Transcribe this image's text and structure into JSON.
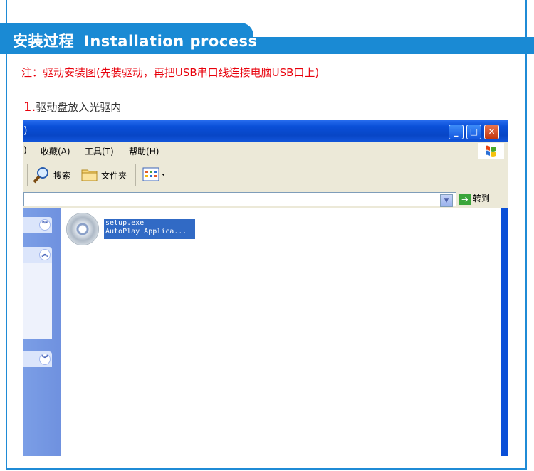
{
  "header": {
    "title_cn": "安装过程",
    "title_en": "Installation process"
  },
  "note": "注：驱动安装图(先装驱动，再把USB串口线连接电脑USB口上)",
  "step": {
    "number": "1.",
    "text": "驱动盘放入光驱内"
  },
  "window": {
    "title_fragment": ")",
    "menu": {
      "fragment": ")",
      "favorites": "收藏(A)",
      "tools": "工具(T)",
      "help": "帮助(H)"
    },
    "toolbar": {
      "search": "搜索",
      "folders": "文件夹"
    },
    "address": {
      "go": "转到"
    },
    "files": [
      "setup.exe",
      "AutoPlay Applica..."
    ]
  },
  "icons": [
    "search-icon",
    "folder-icon",
    "views-icon",
    "windows-logo-icon",
    "cd-icon",
    "go-arrow-icon",
    "chevron-down-icon",
    "chevron-up-icon"
  ],
  "colors": {
    "accent": "#1a8ad4",
    "note_red": "#e8000b",
    "xp_blue": "#0a4fd8",
    "selection": "#316ac5"
  }
}
